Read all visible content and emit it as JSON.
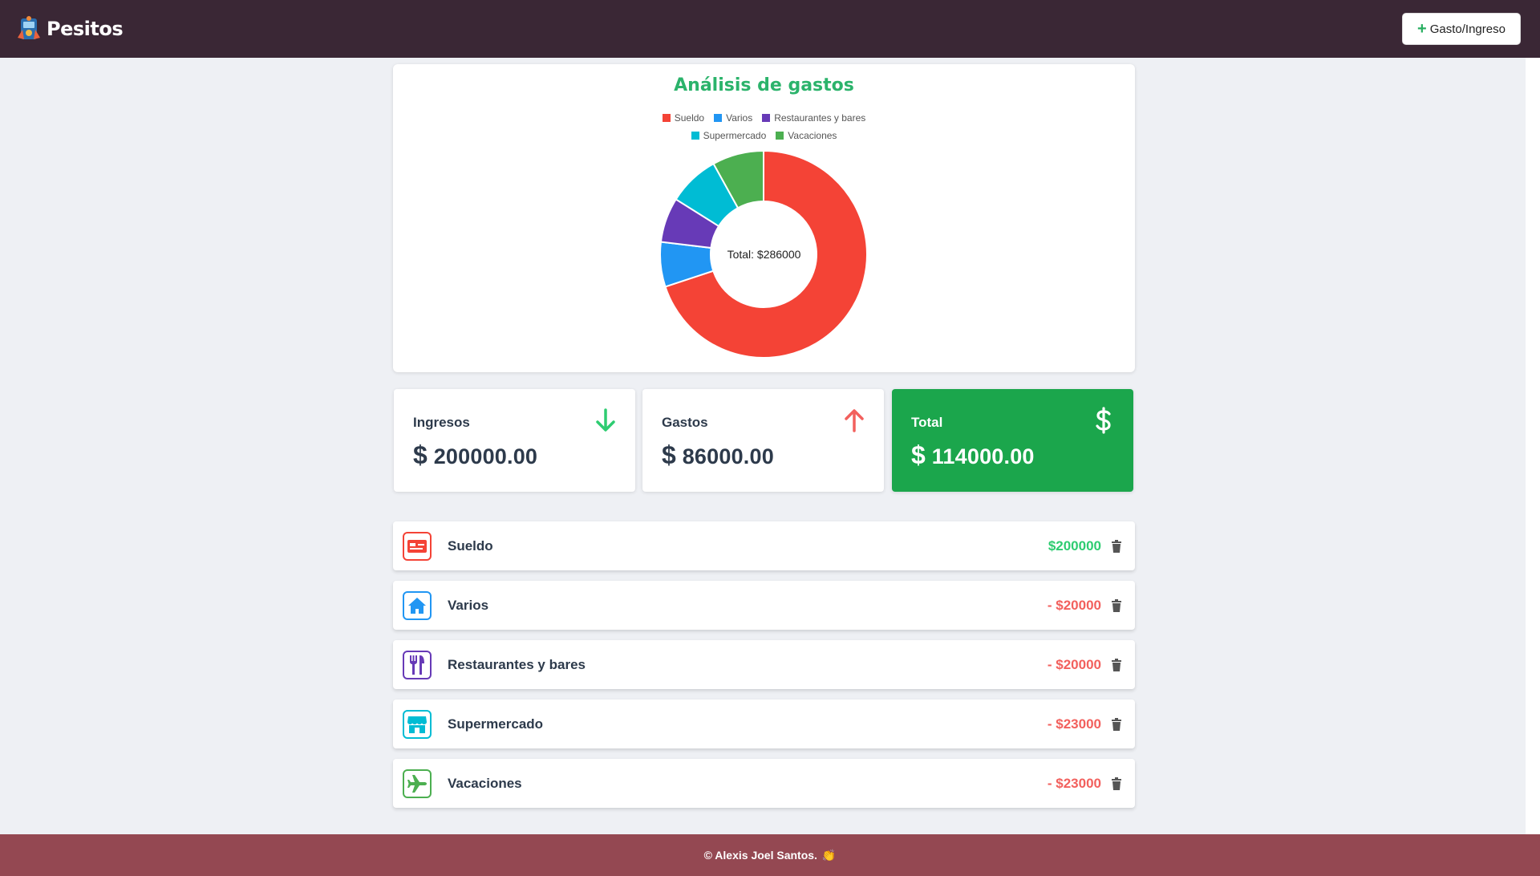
{
  "header": {
    "app_name": "Pesitos",
    "add_button_label": "Gasto/Ingreso"
  },
  "chart": {
    "title": "Análisis de gastos",
    "center_label": "Total: $286000"
  },
  "chart_data": {
    "type": "pie",
    "title": "Análisis de gastos",
    "categories": [
      "Sueldo",
      "Varios",
      "Restaurantes y bares",
      "Supermercado",
      "Vacaciones"
    ],
    "values": [
      200000,
      20000,
      20000,
      23000,
      23000
    ],
    "colors": [
      "#f44336",
      "#2196f3",
      "#673ab7",
      "#00bcd4",
      "#4caf50"
    ],
    "legend_position": "top",
    "center_label": "Total: $286000"
  },
  "summary": {
    "ingresos": {
      "label": "Ingresos",
      "currency": "$",
      "value": "200000.00",
      "icon": "arrow-down-icon"
    },
    "gastos": {
      "label": "Gastos",
      "currency": "$",
      "value": "86000.00",
      "icon": "arrow-up-icon"
    },
    "total": {
      "label": "Total",
      "currency": "$",
      "value": "114000.00",
      "icon": "dollar-icon"
    }
  },
  "transactions": [
    {
      "name": "Sueldo",
      "amount": "$200000",
      "type": "income",
      "icon": "card-icon",
      "color": "#f44336"
    },
    {
      "name": "Varios",
      "amount": "- $20000",
      "type": "expense",
      "icon": "home-icon",
      "color": "#2196f3"
    },
    {
      "name": "Restaurantes y bares",
      "amount": "- $20000",
      "type": "expense",
      "icon": "cutlery-icon",
      "color": "#673ab7"
    },
    {
      "name": "Supermercado",
      "amount": "- $23000",
      "type": "expense",
      "icon": "store-icon",
      "color": "#00bcd4"
    },
    {
      "name": "Vacaciones",
      "amount": "- $23000",
      "type": "expense",
      "icon": "airplane-icon",
      "color": "#4caf50"
    }
  ],
  "footer": {
    "text": "© Alexis Joel Santos.",
    "emoji": "👏"
  }
}
